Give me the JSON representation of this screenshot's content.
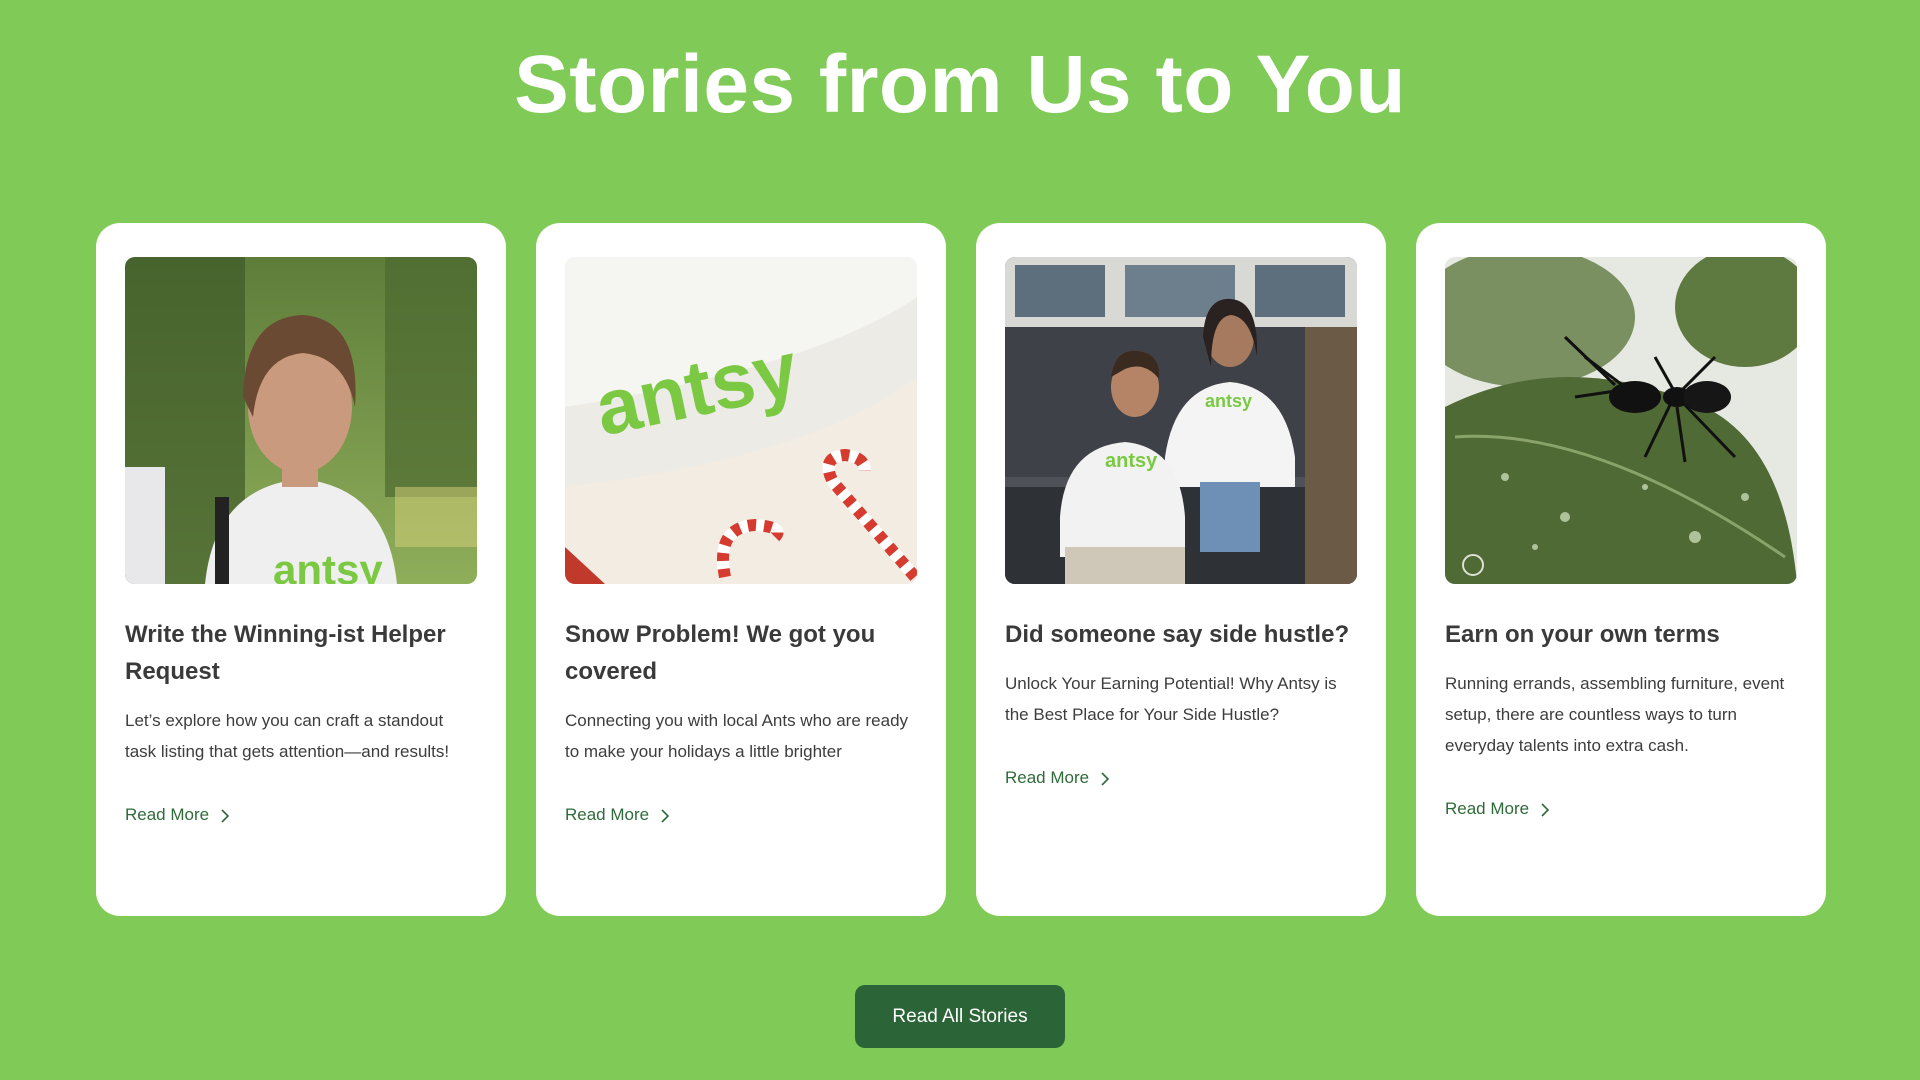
{
  "page": {
    "title": "Stories from Us to You"
  },
  "cards": [
    {
      "title": "Write the Winning-ist Helper Request",
      "description": "Let’s explore how you can craft a standout task listing that gets attention—and results!",
      "read_more": "Read More",
      "image": {
        "shirt_text": "antsy"
      }
    },
    {
      "title": "Snow Problem! We got you covered",
      "description": "Connecting you with local Ants who are ready to make your holidays a little brighter",
      "read_more": "Read More",
      "image": {
        "beanie_text": "antsy"
      }
    },
    {
      "title": "Did someone say side hustle?",
      "description": "Unlock Your Earning Potential! Why Antsy is the Best Place for Your Side Hustle?",
      "read_more": "Read More",
      "image": {
        "shirt_text_left": "antsy",
        "shirt_text_right": "antsy"
      }
    },
    {
      "title": "Earn on your own terms",
      "description": "Running errands, assembling furniture, event setup, there are countless ways to turn everyday talents into extra cash.",
      "read_more": "Read More",
      "image": {}
    }
  ],
  "cta": {
    "label": "Read All Stories"
  },
  "colors": {
    "background": "#80ca57",
    "card": "#ffffff",
    "button": "#2b6436",
    "link": "#2f6b3a",
    "brand_green": "#7bc943"
  }
}
